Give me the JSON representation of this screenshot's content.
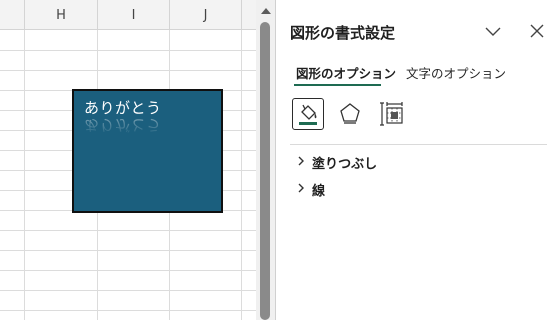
{
  "spreadsheet": {
    "columns": [
      "H",
      "I",
      "J"
    ],
    "shape": {
      "text": "ありがとう",
      "fill_color": "#1b5f7e",
      "text_color": "#ffffff"
    }
  },
  "pane": {
    "title": "図形の書式設定",
    "collapse_icon": "chevron-down-icon",
    "close_icon": "close-icon",
    "tabs": [
      {
        "label": "図形のオプション",
        "active": true
      },
      {
        "label": "文字のオプション",
        "active": false
      }
    ],
    "icon_buttons": [
      {
        "name": "fill-line-icon",
        "active": true
      },
      {
        "name": "effects-pentagon-icon",
        "active": false
      },
      {
        "name": "size-properties-icon",
        "active": false
      }
    ],
    "sections": [
      {
        "label": "塗りつぶし"
      },
      {
        "label": "線"
      }
    ],
    "accent_color": "#1e6b52"
  }
}
